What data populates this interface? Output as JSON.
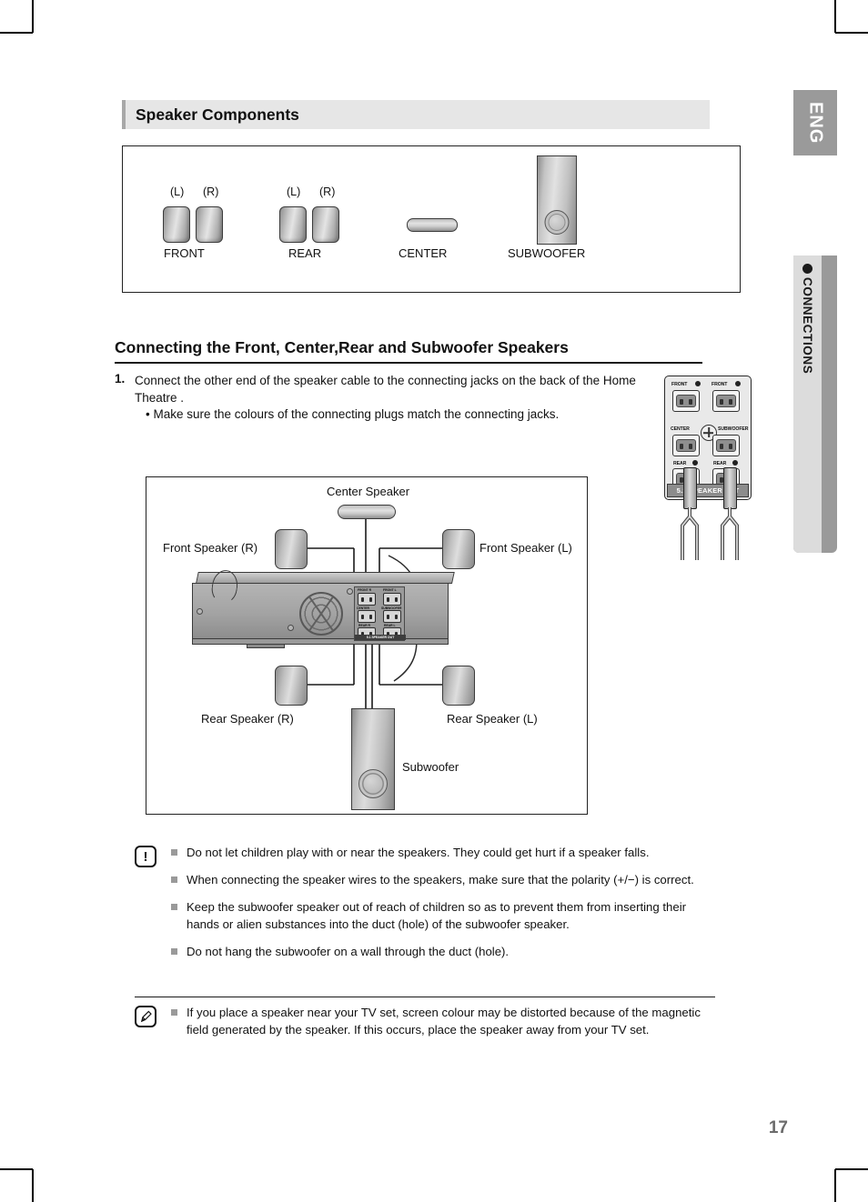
{
  "sidebar": {
    "language_tab": "ENG",
    "section_tab": "CONNECTIONS",
    "bullet_icon": "filled-circle-icon"
  },
  "section_header": {
    "title": "Speaker Components"
  },
  "components": {
    "front": {
      "label": "FRONT",
      "left_marker": "(L)",
      "right_marker": "(R)"
    },
    "rear": {
      "label": "REAR",
      "left_marker": "(L)",
      "right_marker": "(R)"
    },
    "center": {
      "label": "CENTER"
    },
    "subwoofer": {
      "label": "SUBWOOFER"
    }
  },
  "heading": {
    "title": "Connecting the Front, Center,Rear and Subwoofer Speakers"
  },
  "step": {
    "number": "1.",
    "text": "Connect the other end of the speaker cable to the connecting jacks on the back of the Home Theatre .",
    "bullet": "• Make sure the colours of the connecting plugs match the connecting jacks."
  },
  "rear_panel": {
    "jacks": [
      {
        "label": "FRONT",
        "has_dot": true
      },
      {
        "label": "FRONT",
        "has_dot": true
      },
      {
        "label": "CENTER",
        "has_dot": false
      },
      {
        "label": "SUBWOOFER",
        "has_dot": false
      },
      {
        "label": "REAR",
        "has_dot": true
      },
      {
        "label": "REAR",
        "has_dot": true
      }
    ],
    "footer_label": "5.1 SPEAKER OUT"
  },
  "diagram": {
    "center_speaker": "Center Speaker",
    "front_right": "Front Speaker (R)",
    "front_left": "Front Speaker (L)",
    "rear_right": "Rear Speaker (R)",
    "rear_left": "Rear Speaker (L)",
    "subwoofer": "Subwoofer",
    "receiver_jacks": [
      "FRONT R",
      "FRONT L",
      "CENTER",
      "SUBWOOFER",
      "REAR R",
      "REAR L"
    ],
    "receiver_footer": "5.1 SPEAKER OUT"
  },
  "caution": {
    "icon": "exclamation-icon",
    "icon_glyph": "!",
    "items": [
      "Do not let children play with or near the speakers. They could get hurt if a speaker falls.",
      "When connecting the speaker wires to the speakers, make sure that the polarity (+/−) is correct.",
      "Keep the subwoofer speaker out of reach of children so as to prevent them from inserting their hands or alien substances into the duct (hole) of the subwoofer speaker.",
      "Do not hang the subwoofer on a wall through the duct (hole)."
    ]
  },
  "note": {
    "icon": "note-pencil-icon",
    "icon_glyph": "✒",
    "items": [
      "If you place a speaker near your TV set, screen colour may be distorted because of the magnetic field generated by the speaker. If this occurs, place the speaker away from your TV set."
    ]
  },
  "footer": {
    "page_number": "17"
  },
  "colors": {
    "header_bg": "#e6e6e6",
    "header_accent": "#a8a8a8",
    "tab_gray": "#9a9a9a",
    "tab_light": "#dcdcdc",
    "page_number": "#6b6b6b",
    "bullet_square": "#9a9a9a"
  }
}
